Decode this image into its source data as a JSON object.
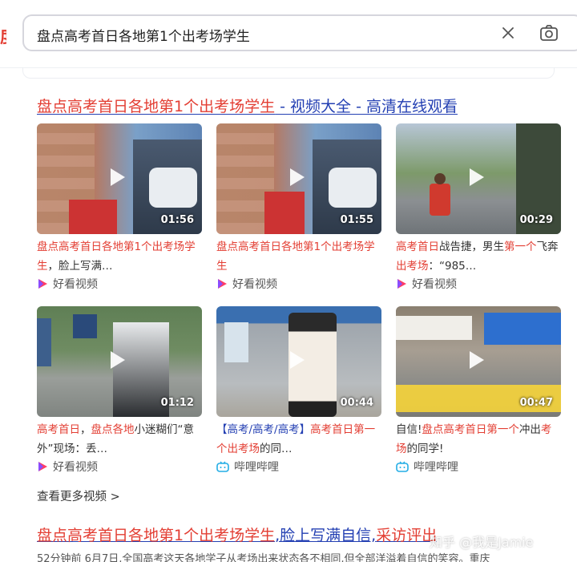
{
  "search": {
    "query": "盘点高考首日各地第1个出考场学生"
  },
  "result1": {
    "title_hl": "盘点高考首日各地第1个出考场学生",
    "title_rest": " - 视频大全 - 高清在线观看",
    "videos": [
      {
        "duration": "01:56",
        "title_parts": [
          {
            "t": "盘点高考首日各地第1个出考场学生",
            "hl": true
          },
          {
            "t": "，脸上写满…",
            "hl": false
          }
        ],
        "source": "好看视频",
        "source_icon": "haokan-icon"
      },
      {
        "duration": "01:55",
        "title_parts": [
          {
            "t": "盘点高考首日各地第1个出考场学生",
            "hl": true
          }
        ],
        "source": "好看视频",
        "source_icon": "haokan-icon"
      },
      {
        "duration": "00:29",
        "title_parts": [
          {
            "t": "高考首日",
            "hl": true
          },
          {
            "t": "战告捷，男生",
            "hl": false
          },
          {
            "t": "第一个",
            "hl": true
          },
          {
            "t": "飞奔",
            "hl": false
          },
          {
            "t": "出考场",
            "hl": true
          },
          {
            "t": "：“985…",
            "hl": false
          }
        ],
        "source": "好看视频",
        "source_icon": "haokan-icon"
      },
      {
        "duration": "01:12",
        "title_parts": [
          {
            "t": "高考首日",
            "hl": true
          },
          {
            "t": "，",
            "hl": false
          },
          {
            "t": "盘点各地",
            "hl": true
          },
          {
            "t": "小迷糊们“意外”现场：丢…",
            "hl": false
          }
        ],
        "source": "好看视频",
        "source_icon": "haokan-icon"
      },
      {
        "duration": "00:44",
        "title_parts": [
          {
            "t": "【高考/高考/高考】",
            "hl": false
          },
          {
            "t": "高考首日第一个出考场",
            "hl": true
          },
          {
            "t": "的同…",
            "hl": false
          }
        ],
        "source": "哔哩哔哩",
        "source_icon": "bilibili-icon"
      },
      {
        "duration": "00:47",
        "title_parts": [
          {
            "t": "自信!",
            "hl": false
          },
          {
            "t": "盘点高考首日第一个",
            "hl": true
          },
          {
            "t": "冲出",
            "hl": false
          },
          {
            "t": "考场",
            "hl": true
          },
          {
            "t": "的同学!",
            "hl": false
          }
        ],
        "source": "哔哩哔哩",
        "source_icon": "bilibili-icon"
      }
    ],
    "more": "查看更多视频 >"
  },
  "result2": {
    "title_hl": "盘点高考首日各地第1个出考场学生",
    "title_rest": ",脸上写满自信,",
    "title_tail": "采访评出",
    "snippet": "52分钟前 6月7日,全国高考这天各地学子从考场出来状态各不相同,但全部洋溢着自信的笑容。重庆"
  },
  "watermark": "知乎 @我是Jamie",
  "colors": {
    "link": "#2440b3",
    "highlight": "#e33e33",
    "text": "#333333"
  }
}
